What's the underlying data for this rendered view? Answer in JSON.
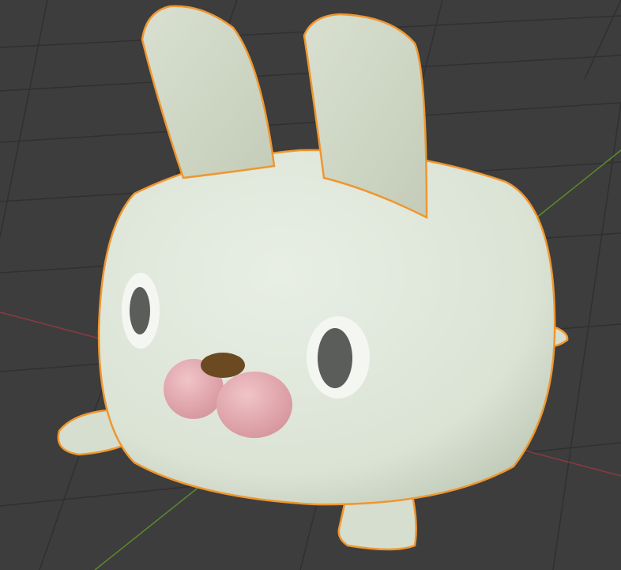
{
  "viewport": {
    "background_color": "#3d3d3d",
    "grid_color": "#303030",
    "x_axis_color": "#8a3a40",
    "y_axis_color": "#5d8a2a",
    "selection_outline_color": "#f0962e"
  },
  "model": {
    "body_color": "#dfe6da",
    "ear_color": "#d3dbc9",
    "eye_outer_color": "#f4f6f2",
    "eye_inner_color": "#5a5d5a",
    "cheek_color": "#e6aeb4",
    "nose_color": "#6b4a22"
  }
}
